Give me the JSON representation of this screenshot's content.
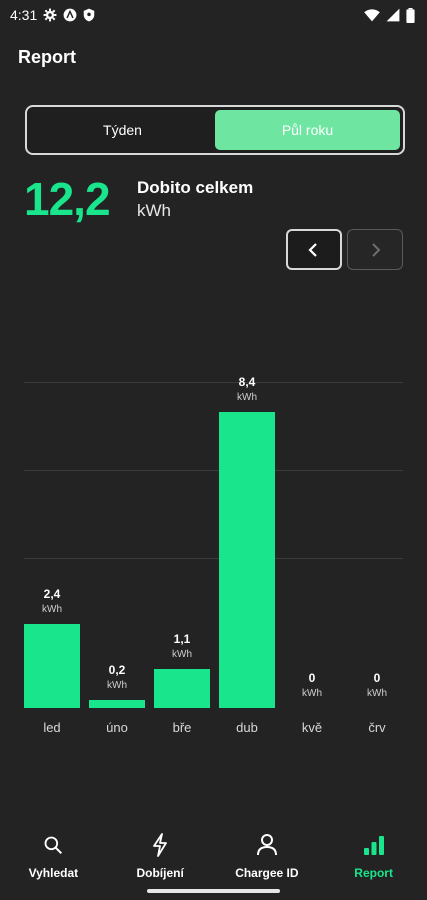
{
  "status": {
    "time": "4:31"
  },
  "header": {
    "title": "Report"
  },
  "period_toggle": {
    "options": [
      "Týden",
      "Půl roku"
    ],
    "selected": "Půl roku"
  },
  "summary": {
    "value": "12,2",
    "label": "Dobito celkem",
    "unit": "kWh"
  },
  "chart_data": {
    "type": "bar",
    "categories": [
      "led",
      "úno",
      "bře",
      "dub",
      "kvě",
      "črv"
    ],
    "values": [
      2.4,
      0.2,
      1.1,
      8.4,
      0,
      0
    ],
    "value_labels": [
      "2,4",
      "0,2",
      "1,1",
      "8,4",
      "0",
      "0"
    ],
    "unit": "kWh",
    "ylim": [
      0,
      10
    ],
    "grid": true,
    "color": "#19e68c"
  },
  "bottom_nav": {
    "items": [
      {
        "label": "Vyhledat",
        "icon": "search-icon"
      },
      {
        "label": "Dobíjení",
        "icon": "bolt-icon"
      },
      {
        "label": "Chargee ID",
        "icon": "person-icon"
      },
      {
        "label": "Report",
        "icon": "signal-bars-icon"
      }
    ],
    "active": "Report"
  },
  "colors": {
    "accent": "#19e68c",
    "toggle_active": "#6ee6a2",
    "background": "#232323"
  }
}
